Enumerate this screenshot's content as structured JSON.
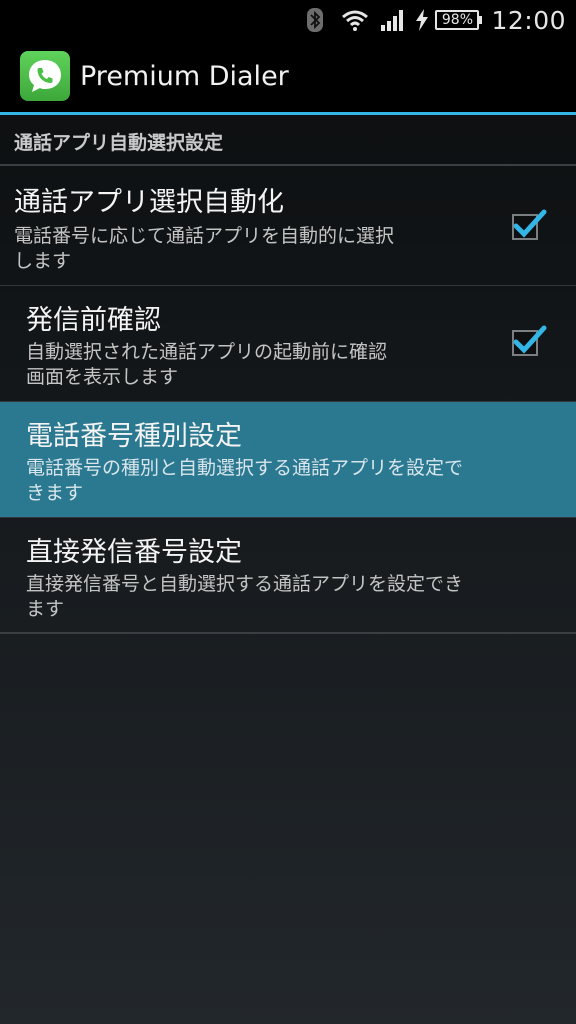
{
  "status_bar": {
    "battery": "98%",
    "time": "12:00",
    "icons": [
      "bluetooth-icon",
      "wifi-icon",
      "signal-icon",
      "charging-icon",
      "battery-icon"
    ]
  },
  "action_bar": {
    "app_icon": "phone-bubble-icon",
    "title": "Premium Dialer",
    "accent_color": "#33b5e5"
  },
  "category": {
    "label": "通話アプリ自動選択設定"
  },
  "preferences": [
    {
      "title": "通話アプリ選択自動化",
      "summary_line1": "電話番号に応じて通話アプリを自動的に選択",
      "summary_line2": "します",
      "checked": true
    },
    {
      "title": "発信前確認",
      "summary_line1": "自動選択された通話アプリの起動前に確認",
      "summary_line2": "画面を表示します",
      "checked": true
    },
    {
      "title": "電話番号種別設定",
      "summary_line1": "電話番号の種別と自動選択する通話アプリを設定で",
      "summary_line2": "きます",
      "highlighted": true,
      "highlight_color": "#2b7891"
    },
    {
      "title": "直接発信番号設定",
      "summary_line1": "直接発信番号と自動選択する通話アプリを設定でき",
      "summary_line2": "ます"
    }
  ]
}
